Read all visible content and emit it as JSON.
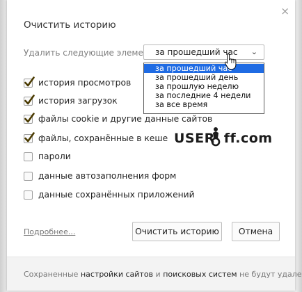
{
  "dialog": {
    "title": "Очистить историю",
    "remove_label": "Удалить следующие элементы:",
    "period_select": {
      "value": "за прошедший час",
      "options": [
        "за прошедший час",
        "за прошедший день",
        "за прошлую неделю",
        "за последние 4 недели",
        "за все время"
      ],
      "selected_index": 0
    },
    "options": [
      {
        "label": "история просмотров",
        "checked": true
      },
      {
        "label": "история загрузок",
        "checked": true
      },
      {
        "label": "файлы cookie и другие данные сайтов",
        "checked": true
      },
      {
        "label": "файлы, сохранённые в кеше",
        "checked": true
      },
      {
        "label": "пароли",
        "checked": false
      },
      {
        "label": "данные автозаполнения форм",
        "checked": false
      },
      {
        "label": "данные сохранённых приложений",
        "checked": false
      }
    ],
    "more_link": "Подробнее...",
    "clear_button": "Очистить историю",
    "cancel_button": "Отмена",
    "footer": {
      "part1": "Сохраненные ",
      "link1": "настройки сайтов",
      "part2": " и ",
      "link2": "поисковых систем",
      "part3": " не будут удалены."
    },
    "close_glyph": "×"
  },
  "watermark": {
    "left": "USER",
    "right": "ff.com"
  },
  "colors": {
    "selection": "#1f6be3",
    "check": "#4a3a00"
  }
}
